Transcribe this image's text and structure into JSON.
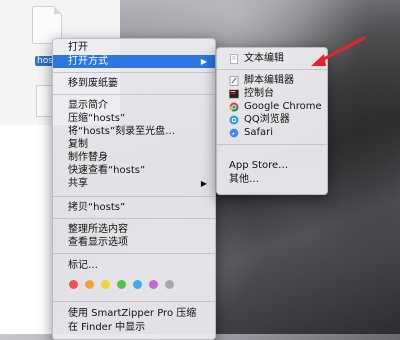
{
  "file": {
    "name": "host"
  },
  "context_menu": {
    "items": [
      {
        "label": "打开"
      },
      {
        "label": "打开方式",
        "selected": true,
        "submenu": true
      },
      {
        "label": "移到废纸篓"
      },
      {
        "label": "显示简介"
      },
      {
        "label": "压缩“hosts”"
      },
      {
        "label": "将“hosts”刻录至光盘…"
      },
      {
        "label": "复制"
      },
      {
        "label": "制作替身"
      },
      {
        "label": "快速查看“hosts”"
      },
      {
        "label": "共享",
        "submenu": true
      },
      {
        "label": "拷贝“hosts”"
      },
      {
        "label": "整理所选内容"
      },
      {
        "label": "查看显示选项"
      },
      {
        "label": "标记…"
      },
      {
        "label": "使用 SmartZipper Pro 压缩"
      },
      {
        "label": "在 Finder 中显示"
      }
    ],
    "tag_colors": [
      "#f0524b",
      "#f5a13b",
      "#f2d13b",
      "#55c04a",
      "#44a7f2",
      "#c06ad6",
      "#a8a8ad"
    ]
  },
  "open_with_submenu": {
    "items": [
      {
        "label": "文本编辑",
        "icon": "text-edit-icon"
      },
      {
        "label": "脚本编辑器",
        "icon": "script-editor-icon"
      },
      {
        "label": "控制台",
        "icon": "console-icon"
      },
      {
        "label": "Google Chrome",
        "icon": "chrome-icon"
      },
      {
        "label": "QQ浏览器",
        "icon": "qq-browser-icon"
      },
      {
        "label": "Safari",
        "icon": "safari-icon"
      },
      {
        "label": "App Store…"
      },
      {
        "label": "其他…"
      }
    ]
  },
  "colors": {
    "selection": "#2b76e0",
    "annotation_arrow": "#e8242a"
  }
}
